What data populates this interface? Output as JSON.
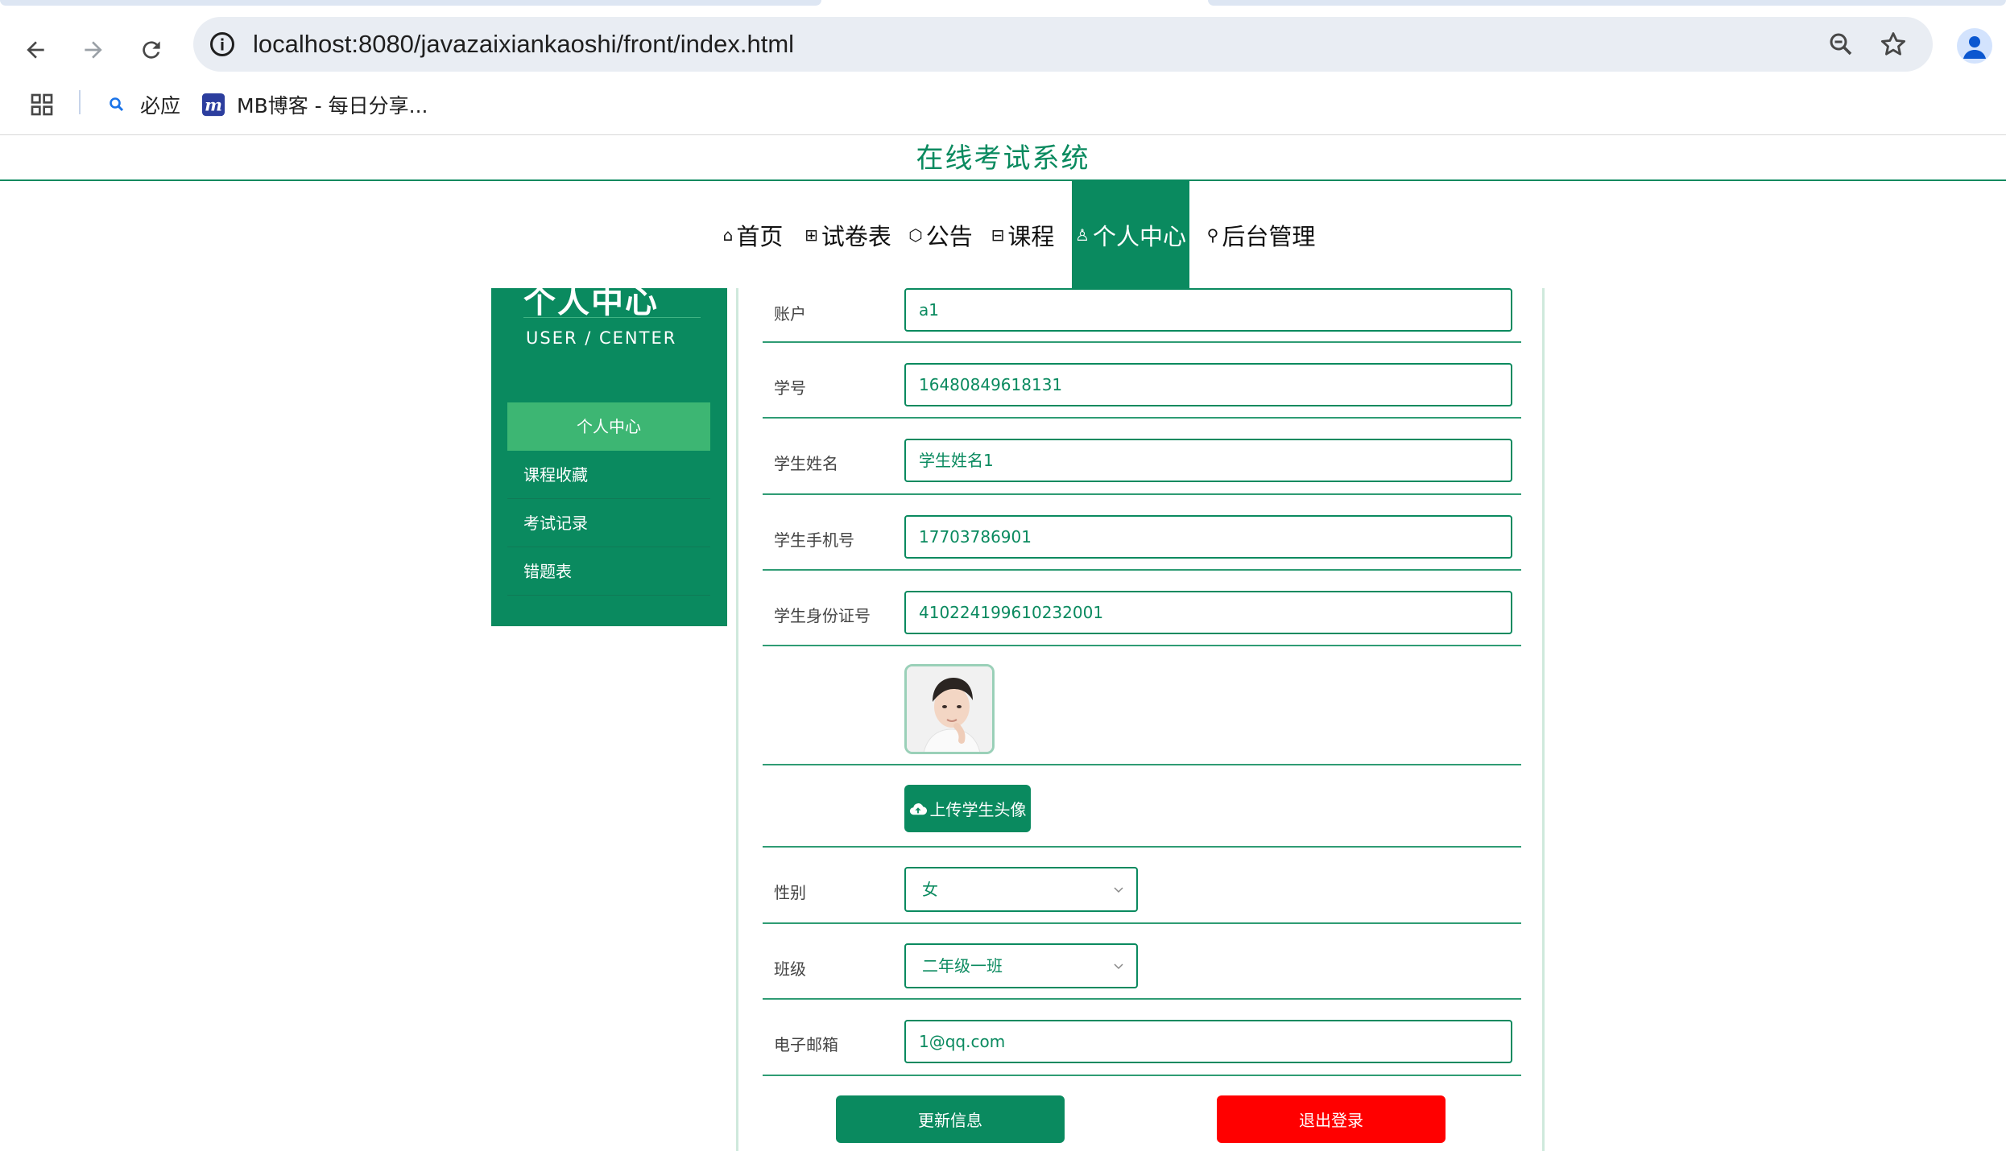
{
  "browser": {
    "url": "localhost:8080/javazaixiankaoshi/front/index.html",
    "bookmarks": [
      {
        "label": "必应",
        "icon": "search-icon"
      },
      {
        "label": "MB博客 - 每日分享...",
        "icon": "m-logo-icon"
      }
    ]
  },
  "site": {
    "title": "在线考试系统"
  },
  "nav": {
    "items": [
      {
        "label": "首页",
        "icon": "⌂"
      },
      {
        "label": "试卷表",
        "icon": "⊞"
      },
      {
        "label": "公告",
        "icon": "⬡"
      },
      {
        "label": "课程",
        "icon": "⊟"
      },
      {
        "label": "个人中心",
        "icon": "♙"
      },
      {
        "label": "后台管理",
        "icon": "⚲"
      }
    ],
    "active": "个人中心"
  },
  "sidebar": {
    "title": "个人中心",
    "subtitle": "USER / CENTER",
    "items": [
      {
        "label": "个人中心"
      },
      {
        "label": "课程收藏"
      },
      {
        "label": "考试记录"
      },
      {
        "label": "错题表"
      }
    ]
  },
  "form": {
    "fields": [
      {
        "label": "账户",
        "value": "a1"
      },
      {
        "label": "学号",
        "value": "16480849618131"
      },
      {
        "label": "学生姓名",
        "value": "学生姓名1"
      },
      {
        "label": "学生手机号",
        "value": "17703786901"
      },
      {
        "label": "学生身份证号",
        "value": "410224199610232001"
      }
    ],
    "upload_label": "上传学生头像",
    "gender": {
      "label": "性别",
      "value": "女"
    },
    "class": {
      "label": "班级",
      "value": "二年级一班"
    },
    "email": {
      "label": "电子邮箱",
      "value": "1@qq.com"
    },
    "update_label": "更新信息",
    "logout_label": "退出登录"
  },
  "colors": {
    "primary": "#0a8a5f",
    "sidebar_active": "#3db673",
    "danger": "#ff0000"
  }
}
